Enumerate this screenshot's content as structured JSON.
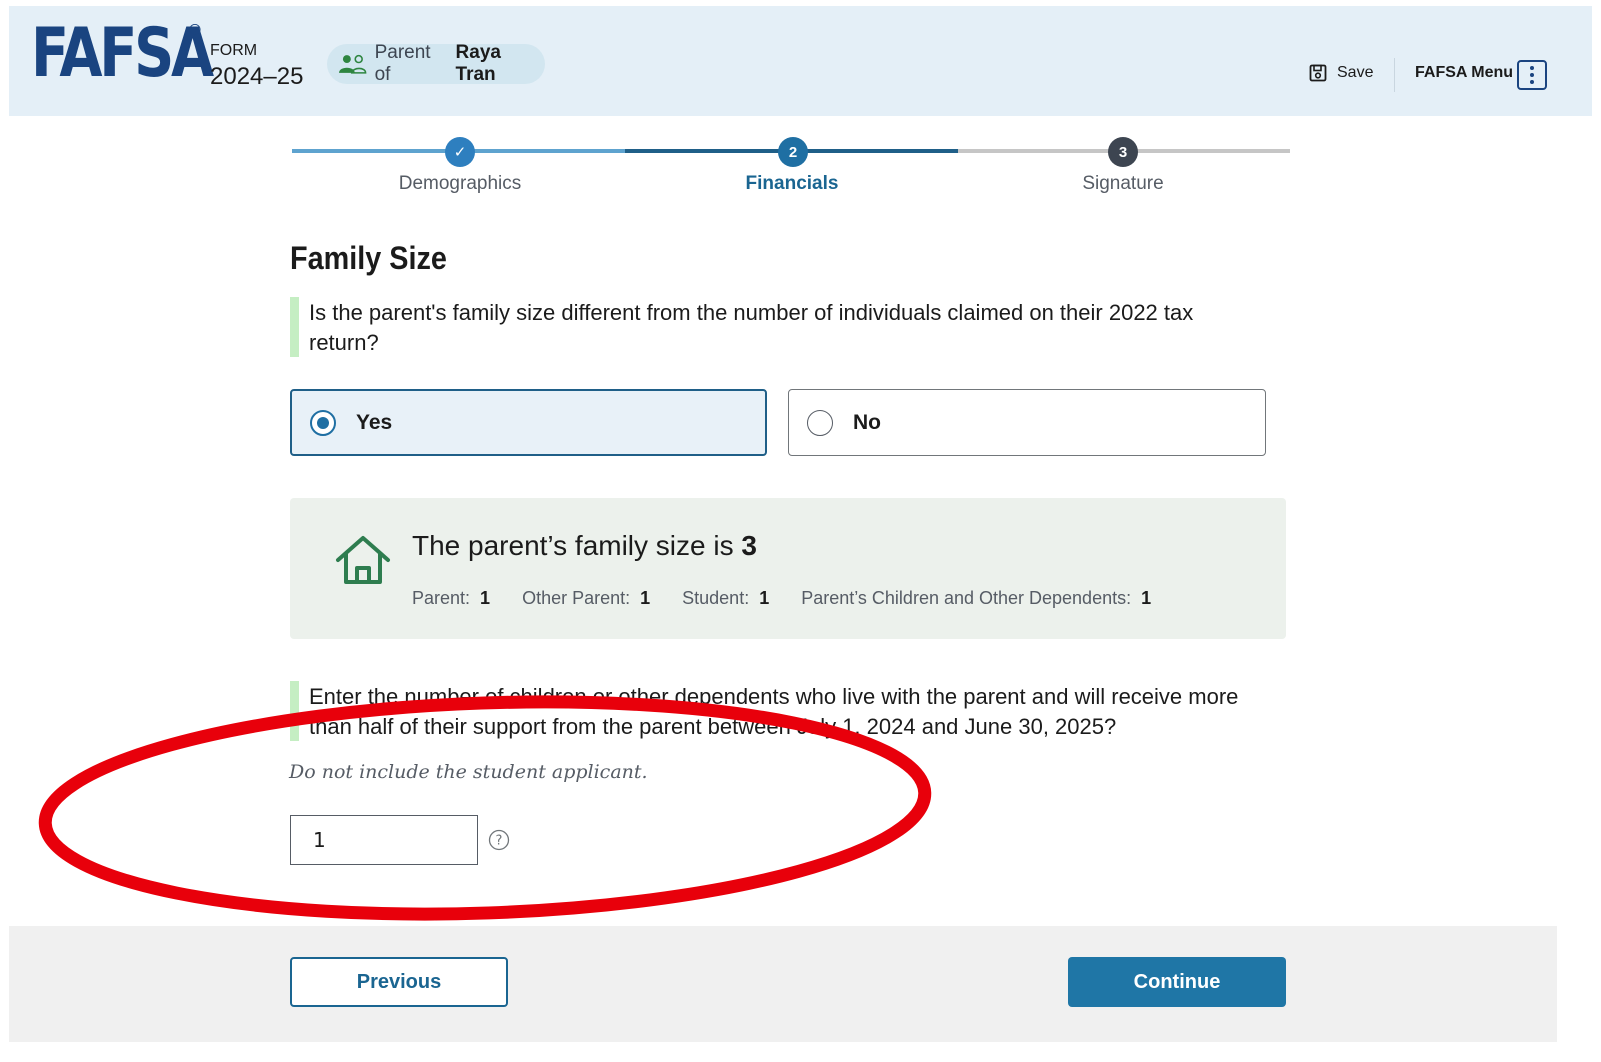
{
  "header": {
    "logo": "FAFSA",
    "logo_mark": "®",
    "form_label": "FORM",
    "form_year": "2024–25",
    "role_prefix": "Parent of",
    "role_name": "Raya Tran",
    "save_label": "Save",
    "menu_label": "FAFSA Menu",
    "icons": {
      "role": "people-icon",
      "save": "floppy-disk-icon",
      "menu": "kebab-menu-icon"
    }
  },
  "stepper": {
    "steps": [
      {
        "label": "Demographics",
        "marker": "✓",
        "state": "complete"
      },
      {
        "label": "Financials",
        "marker": "2",
        "state": "current"
      },
      {
        "label": "Signature",
        "marker": "3",
        "state": "upcoming"
      }
    ]
  },
  "main": {
    "title": "Family Size",
    "question1": "Is the parent's family size different from the number of individuals claimed on their 2022 tax return?",
    "options": [
      {
        "label": "Yes",
        "selected": true
      },
      {
        "label": "No",
        "selected": false
      }
    ],
    "summary": {
      "prefix": "The parent’s family size is",
      "total": "3",
      "counts": [
        {
          "label": "Parent:",
          "value": "1"
        },
        {
          "label": "Other Parent:",
          "value": "1"
        },
        {
          "label": "Student:",
          "value": "1"
        },
        {
          "label": "Parent’s Children and Other Dependents:",
          "value": "1"
        }
      ]
    },
    "question2": "Enter the number of children or other dependents who live with the parent and will receive more than half of their support from the parent between July 1, 2024 and June 30, 2025?",
    "hint": "Do not include the student applicant.",
    "dependents_value": "1"
  },
  "footer": {
    "previous_label": "Previous",
    "continue_label": "Continue"
  },
  "colors": {
    "brand_navy": "#1a4480",
    "header_bg": "#e4eff7",
    "primary_button": "#1f76a6",
    "question_bar": "#c5eec3",
    "summary_bg": "#ecf1ec",
    "annotation_red": "#e8000b"
  }
}
